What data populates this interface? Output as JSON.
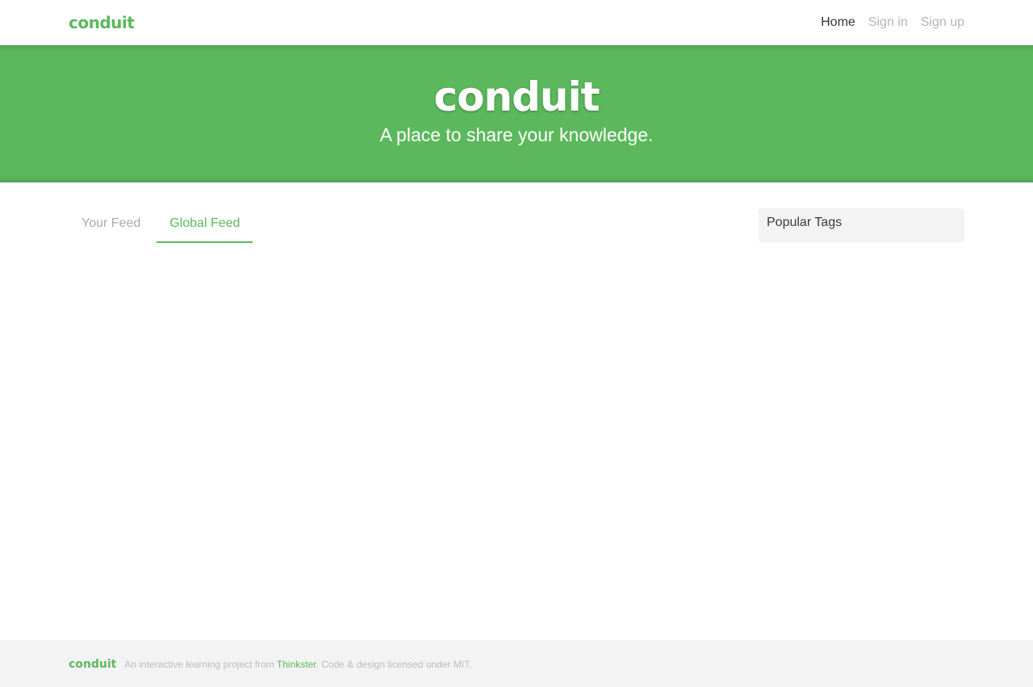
{
  "navbar": {
    "brand": "conduit",
    "links": [
      {
        "label": "Home",
        "active": true
      },
      {
        "label": "Sign in",
        "active": false
      },
      {
        "label": "Sign up",
        "active": false
      }
    ]
  },
  "banner": {
    "title": "conduit",
    "subtitle": "A place to share your knowledge."
  },
  "feed": {
    "tabs": [
      {
        "label": "Your Feed",
        "active": false
      },
      {
        "label": "Global Feed",
        "active": true
      }
    ]
  },
  "sidebar": {
    "title": "Popular Tags"
  },
  "footer": {
    "brand": "conduit",
    "text_before": "An interactive learning project from ",
    "link": "Thinkster",
    "text_after": ". Code & design licensed under MIT."
  },
  "colors": {
    "brand": "#5cb85c",
    "footer_bg": "#f3f3f3",
    "sidebar_bg": "#f3f3f3"
  }
}
